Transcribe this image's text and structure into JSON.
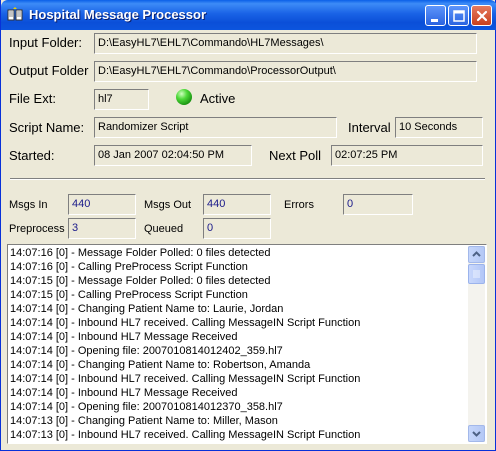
{
  "window": {
    "title": "Hospital Message Processor"
  },
  "fields": {
    "input_folder": {
      "label": "Input Folder:",
      "value": "D:\\EasyHL7\\EHL7\\Commando\\HL7Messages\\"
    },
    "output_folder": {
      "label": "Output Folder",
      "value": "D:\\EasyHL7\\EHL7\\Commando\\ProcessorOutput\\"
    },
    "file_ext": {
      "label": "File Ext:",
      "value": "hl7"
    },
    "status": {
      "label": "Active",
      "color": "#2fbf1f"
    },
    "script_name": {
      "label": "Script Name:",
      "value": "Randomizer Script"
    },
    "interval": {
      "label": "Interval",
      "value": "10 Seconds"
    },
    "started": {
      "label": "Started:",
      "value": "08 Jan 2007 02:04:50 PM"
    },
    "next_poll": {
      "label": "Next Poll",
      "value": "02:07:25 PM"
    }
  },
  "stats": {
    "msgs_in": {
      "label": "Msgs In",
      "value": "440"
    },
    "msgs_out": {
      "label": "Msgs Out",
      "value": "440"
    },
    "errors": {
      "label": "Errors",
      "value": "0"
    },
    "preprocess": {
      "label": "Preprocess",
      "value": "3"
    },
    "queued": {
      "label": "Queued",
      "value": "0"
    }
  },
  "log": [
    "14:07:16 [0] - Message Folder Polled: 0 files detected",
    "14:07:16 [0] - Calling PreProcess Script Function",
    "14:07:15 [0] - Message Folder Polled: 0 files detected",
    "14:07:15 [0] - Calling PreProcess Script Function",
    "14:07:14 [0] - Changing Patient Name to: Laurie, Jordan",
    "14:07:14 [0] - Inbound HL7 received. Calling MessageIN Script Function",
    "14:07:14 [0] - Inbound HL7 Message Received",
    "14:07:14 [0] - Opening file: 2007010814012402_359.hl7",
    "14:07:14 [0] - Changing Patient Name to: Robertson, Amanda",
    "14:07:14 [0] - Inbound HL7 received. Calling MessageIN Script Function",
    "14:07:14 [0] - Inbound HL7 Message Received",
    "14:07:14 [0] - Opening file: 2007010814012370_358.hl7",
    "14:07:13 [0] - Changing Patient Name to: Miller, Mason",
    "14:07:13 [0] - Inbound HL7 received. Calling MessageIN Script Function"
  ]
}
